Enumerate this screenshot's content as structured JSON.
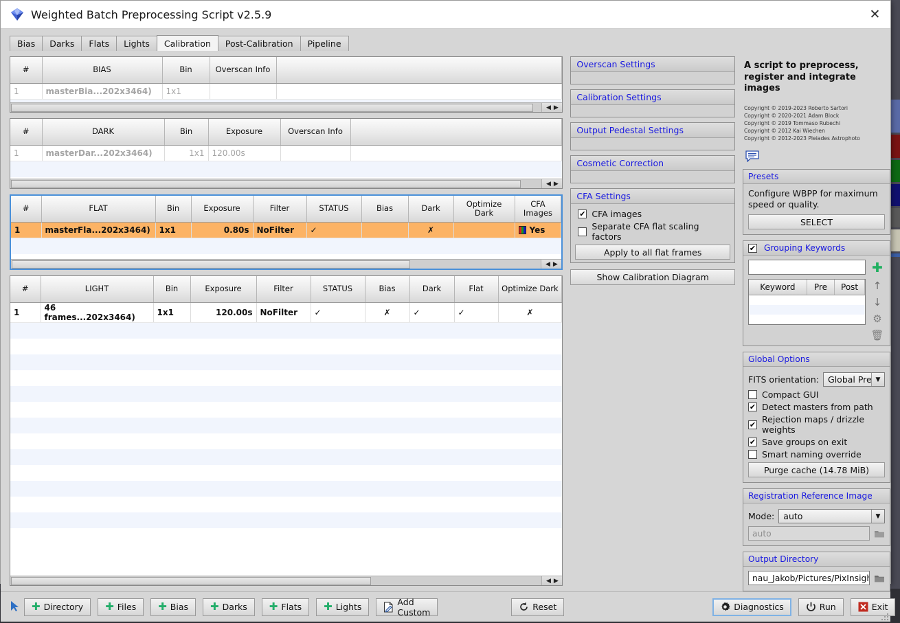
{
  "window": {
    "title": "Weighted Batch Preprocessing Script v2.5.9",
    "app_icon": "diamond-icon",
    "close_icon": "✕"
  },
  "tabs": [
    {
      "label": "Bias",
      "active": false
    },
    {
      "label": "Darks",
      "active": false
    },
    {
      "label": "Flats",
      "active": false
    },
    {
      "label": "Lights",
      "active": false
    },
    {
      "label": "Calibration",
      "active": true
    },
    {
      "label": "Post-Calibration",
      "active": false
    },
    {
      "label": "Pipeline",
      "active": false
    }
  ],
  "tables": {
    "bias": {
      "headers": [
        "#",
        "BIAS",
        "Bin",
        "Overscan Info",
        ""
      ],
      "rows": [
        {
          "num": "1",
          "name": "masterBia...202x3464)",
          "bin": "1x1",
          "overscan": "",
          "extra": "",
          "state": "disabled"
        }
      ]
    },
    "dark": {
      "headers": [
        "#",
        "DARK",
        "Bin",
        "Exposure",
        "Overscan Info",
        ""
      ],
      "rows": [
        {
          "num": "1",
          "name": "masterDar...202x3464)",
          "bin": "1x1",
          "exposure": "120.00s",
          "overscan": "",
          "extra": "",
          "state": "disabled"
        }
      ]
    },
    "flat": {
      "headers": [
        "#",
        "FLAT",
        "Bin",
        "Exposure",
        "Filter",
        "STATUS",
        "Bias",
        "Dark",
        "Optimize Dark",
        "CFA Images"
      ],
      "rows": [
        {
          "num": "1",
          "name": "masterFla...202x3464)",
          "bin": "1x1",
          "exposure": "0.80s",
          "filter": "NoFilter",
          "status": "✓",
          "bias": "",
          "dark": "✗",
          "optimize_dark": "",
          "cfa_images": "Yes",
          "state": "highlighted"
        }
      ]
    },
    "light": {
      "headers": [
        "#",
        "LIGHT",
        "Bin",
        "Exposure",
        "Filter",
        "STATUS",
        "Bias",
        "Dark",
        "Flat",
        "Optimize Dark"
      ],
      "rows": [
        {
          "num": "1",
          "name": "46 frames...202x3464)",
          "bin": "1x1",
          "exposure": "120.00s",
          "filter": "NoFilter",
          "status": "✓",
          "bias": "✗",
          "dark": "✓",
          "flat": "✓",
          "optimize_dark": "✗",
          "state": "normal"
        }
      ]
    }
  },
  "settings_sections": [
    {
      "label": "Overscan Settings",
      "collapsed": true
    },
    {
      "label": "Calibration Settings",
      "collapsed": true
    },
    {
      "label": "Output Pedestal Settings",
      "collapsed": true
    },
    {
      "label": "Cosmetic Correction",
      "collapsed": true
    }
  ],
  "cfa_settings": {
    "title": "CFA Settings",
    "cfa_images": {
      "label": "CFA images",
      "checked": true,
      "mark": "✔"
    },
    "separate_cfa": {
      "label": "Separate CFA flat scaling factors",
      "checked": false,
      "mark": ""
    },
    "apply_button": "Apply to all flat frames"
  },
  "show_calibration_diagram": "Show Calibration Diagram",
  "sidebar": {
    "headline": "A script to preprocess, register and integrate images",
    "copyright": [
      "Copyright © 2019-2023 Roberto Sartori",
      "Copyright © 2020-2021 Adam Block",
      "Copyright © 2019 Tommaso Rubechi",
      "Copyright © 2012 Kai Wiechen",
      "Copyright © 2012-2023 Pleiades Astrophoto"
    ],
    "doc_icon": "speech-bubble-icon",
    "presets": {
      "title": "Presets",
      "description": "Configure WBPP for maximum speed or quality.",
      "select_button": "SELECT"
    },
    "grouping_keywords": {
      "title": "Grouping Keywords",
      "checked": true,
      "mark": "✔",
      "input_value": "",
      "input_placeholder": "",
      "columns": [
        "Keyword",
        "Pre",
        "Post"
      ],
      "rows": [],
      "tools": [
        "add-icon",
        "move-up-icon",
        "move-down-icon",
        "settings-icon",
        "delete-icon"
      ]
    },
    "global_options": {
      "title": "Global Options",
      "fits_orientation": {
        "label": "FITS orientation:",
        "value": "Global Pref"
      },
      "checkboxes": [
        {
          "label": "Compact GUI",
          "checked": false,
          "mark": ""
        },
        {
          "label": "Detect masters from path",
          "checked": true,
          "mark": "✔"
        },
        {
          "label": "Rejection maps / drizzle weights",
          "checked": true,
          "mark": "✔"
        },
        {
          "label": "Save groups on exit",
          "checked": true,
          "mark": "✔"
        },
        {
          "label": "Smart naming override",
          "checked": false,
          "mark": ""
        }
      ],
      "purge_button": "Purge cache (14.78 MiB)"
    },
    "registration_reference": {
      "title": "Registration Reference Image",
      "mode_label": "Mode:",
      "mode_value": "auto",
      "path_placeholder": "auto",
      "path_value": ""
    },
    "output_directory": {
      "title": "Output Directory",
      "path_value": "nau_Jakob/Pictures/PixInsight"
    }
  },
  "toolbar": {
    "left_buttons": [
      {
        "label": "Directory",
        "icon": "plus-icon"
      },
      {
        "label": "Files",
        "icon": "plus-icon"
      },
      {
        "label": "Bias",
        "icon": "plus-icon"
      },
      {
        "label": "Darks",
        "icon": "plus-icon"
      },
      {
        "label": "Flats",
        "icon": "plus-icon"
      },
      {
        "label": "Lights",
        "icon": "plus-icon"
      },
      {
        "label": "Add Custom",
        "icon": "document-edit-icon"
      }
    ],
    "reset": {
      "label": "Reset",
      "icon": "reset-icon"
    },
    "diagnostics": {
      "label": "Diagnostics",
      "icon": "gear-icon"
    },
    "run": {
      "label": "Run",
      "icon": "power-icon"
    },
    "exit": {
      "label": "Exit",
      "icon": "close-box-icon"
    }
  },
  "colors": {
    "accent_blue": "#1a1ae0",
    "highlight_orange": "#fcb365",
    "ok_green": "#1eae3a",
    "disabled_gray": "#c8c8c8",
    "focus_blue": "#7fb2e5"
  }
}
